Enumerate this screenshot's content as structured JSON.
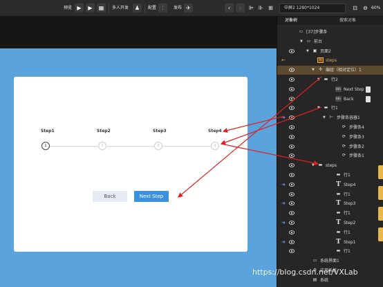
{
  "toolbar": {
    "preview_label": "预览",
    "collab_label": "多人开发",
    "config_label": "配置",
    "publish_label": "发布",
    "device_select": "中屏2 1280*1024",
    "zoom": "60%"
  },
  "canvas": {
    "steps": [
      "Step1",
      "Step2",
      "Step3",
      "Step4"
    ],
    "circles": [
      "1",
      "2",
      "3",
      "4"
    ],
    "back_label": "Back",
    "next_label": "Next Step"
  },
  "panel": {
    "tab_objects": "对象树",
    "tab_search": "搜索对象",
    "rows": [
      "[37]步骤条",
      "前台",
      "页面2",
      "steps",
      "编组（相对定位）1",
      "行2",
      "Next Step",
      "Back",
      "行1",
      "步骤条容器1",
      "步骤条4",
      "步骤条3",
      "步骤条2",
      "步骤条1",
      "steps",
      "行1",
      "Step4",
      "行1",
      "Step3",
      "行1",
      "Step2",
      "行1",
      "Step1",
      "行1",
      "系统界面1",
      "应用系统",
      "系统"
    ]
  },
  "watermark": "https://blog.csdn.net/VXLab",
  "colors": {
    "accent": "#3c92df",
    "canvas_bg": "#5ba3dd",
    "arrow": "#e02020"
  }
}
